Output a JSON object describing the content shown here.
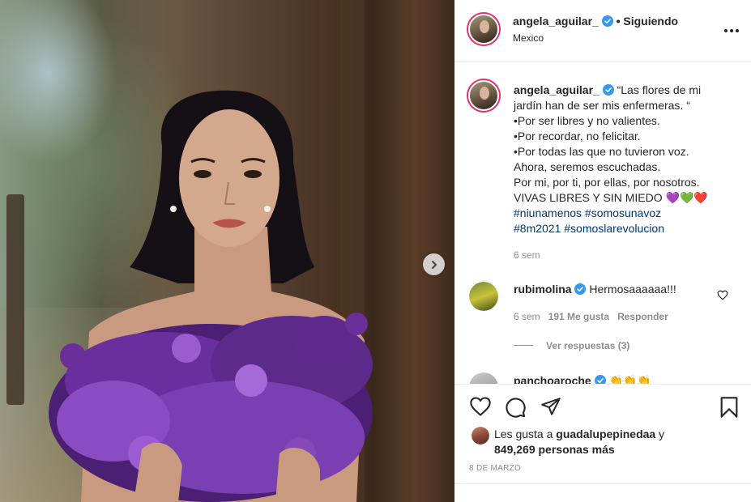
{
  "post": {
    "username": "angela_aguilar_",
    "follow_status": "• Siguiendo",
    "location": "Mexico"
  },
  "caption": {
    "username": "angela_aguilar_",
    "lines": [
      "“Las flores de mi",
      "jardín han de ser mis enfermeras. “",
      "•Por ser libres y no valientes.",
      "•Por recordar, no felicitar.",
      "•Por todas las que no tuvieron voz.",
      "Ahora, seremos escuchadas.",
      "Por mi, por ti, por ellas, por nosotros.",
      "VIVAS LIBRES Y SIN MIEDO"
    ],
    "emoji": "💜💚❤️",
    "hashtags_1": "#niunamenos #somosunavoz",
    "hashtags_2": "#8m2021 #somoslarevolucion",
    "time": "6 sem"
  },
  "comments": [
    {
      "username": "rubimolina",
      "text": "Hermosaaaaaa!!!",
      "time": "6 sem",
      "likes": "191 Me gusta",
      "reply": "Responder",
      "view_replies": "Ver respuestas (3)"
    },
    {
      "username": "panchoaroche",
      "text": "👏👏👏"
    }
  ],
  "likes": {
    "prefix": "Les gusta a",
    "user": "guadalupepinedaa",
    "joiner": "y",
    "count": "849,269 personas más"
  },
  "date": "8 DE MARZO",
  "icons": [
    "verified-badge-icon",
    "more-options-icon",
    "heart-icon",
    "comment-icon",
    "share-icon",
    "bookmark-icon",
    "chevron-right-icon"
  ],
  "colors": {
    "verified": "#3897f0",
    "hashtag": "#00376b",
    "muted": "#8e8e8e",
    "story_ring": "#e1306c"
  }
}
